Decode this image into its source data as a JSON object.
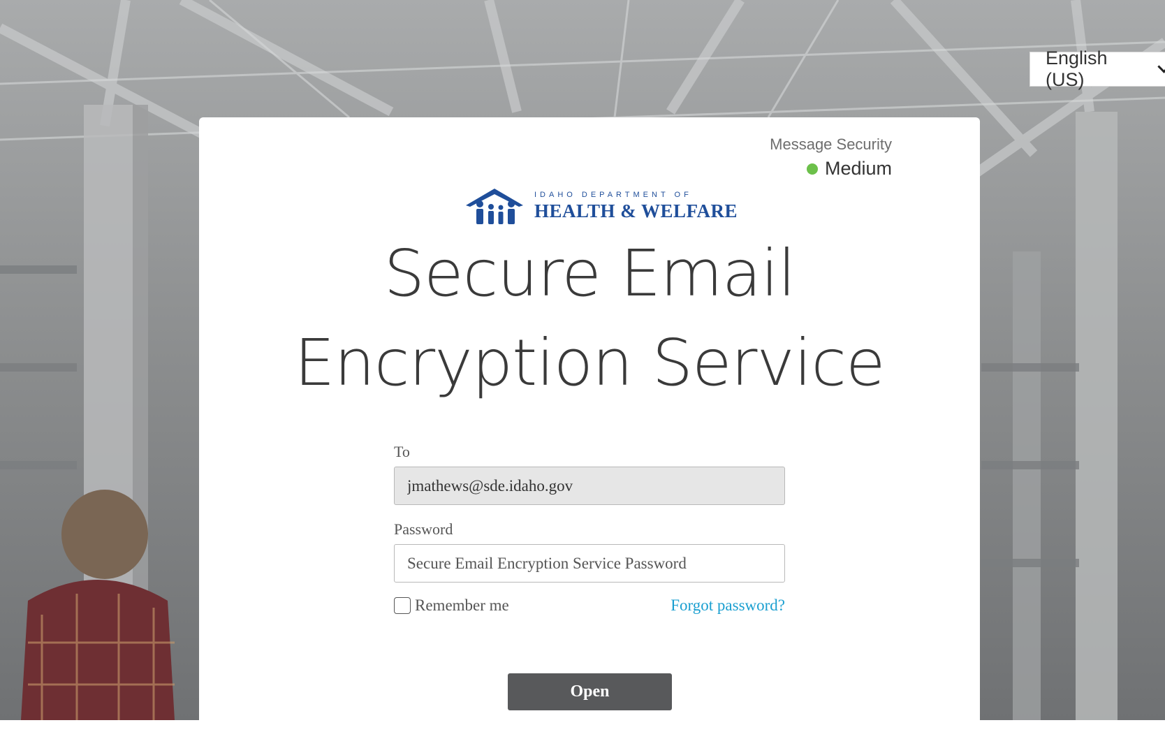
{
  "language": {
    "selected": "English (US)"
  },
  "security": {
    "label": "Message Security",
    "level": "Medium",
    "level_color": "#6cc04a"
  },
  "logo": {
    "line1": "IDAHO DEPARTMENT OF",
    "line2": "HEALTH & WELFARE",
    "color": "#1f4e9a"
  },
  "title": {
    "line1": "Secure Email",
    "line2": "Encryption Service"
  },
  "form": {
    "to_label": "To",
    "to_value": "jmathews@sde.idaho.gov",
    "password_label": "Password",
    "password_placeholder": "Secure Email Encryption Service Password",
    "remember_label": "Remember me",
    "forgot_label": "Forgot password?",
    "open_label": "Open"
  },
  "icons": [
    "chevron-down-icon",
    "status-dot-icon",
    "family-logo-icon"
  ]
}
